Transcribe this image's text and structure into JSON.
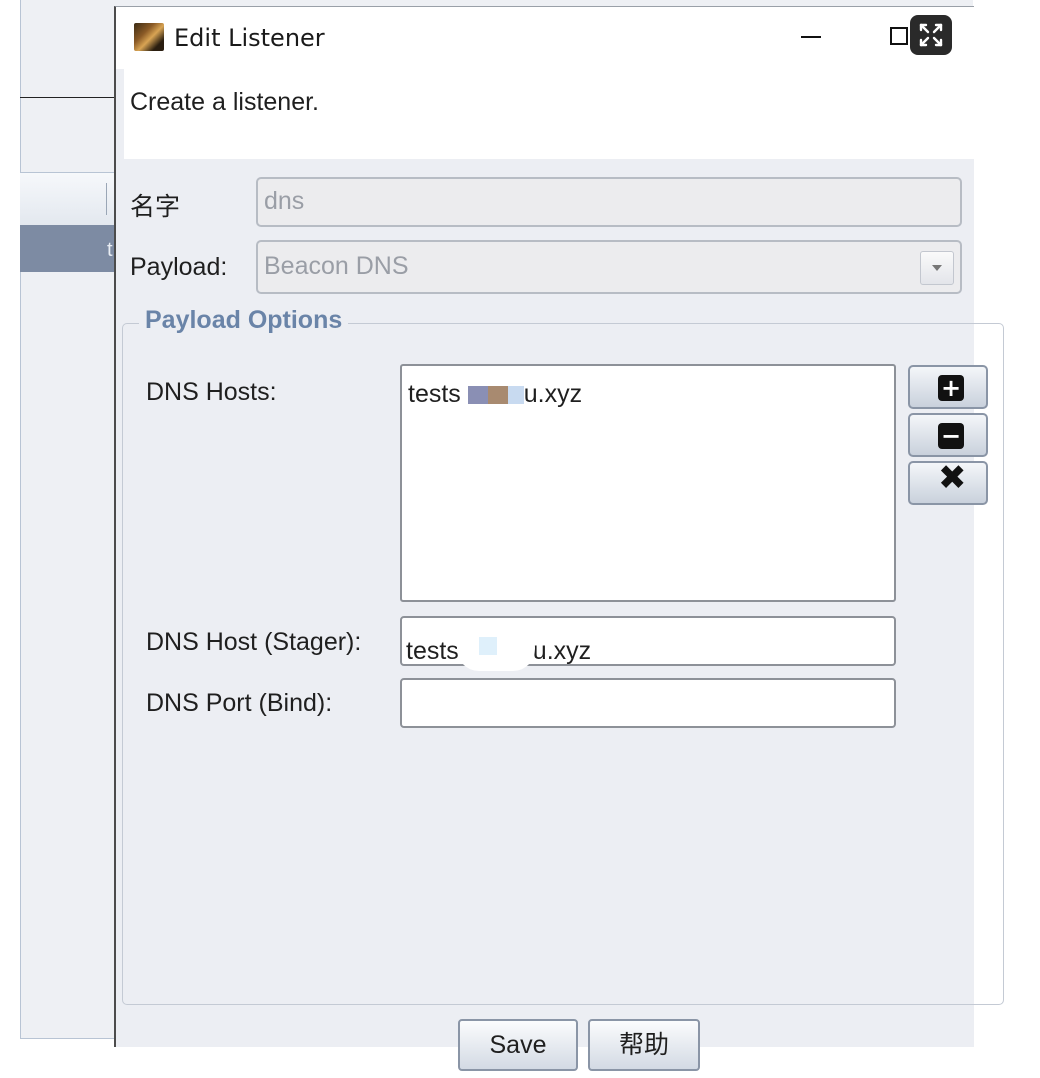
{
  "background_app": {
    "row_cell_text": "t"
  },
  "window": {
    "title": "Edit Listener",
    "description": "Create a listener."
  },
  "form": {
    "name_label": "名字",
    "name_value": "dns",
    "payload_label": "Payload:",
    "payload_value": "Beacon DNS"
  },
  "payload_options": {
    "legend": "Payload Options",
    "dns_hosts_label": "DNS Hosts:",
    "dns_hosts": [
      {
        "prefix": "tests",
        "suffix": "u.xyz"
      }
    ],
    "dns_host_stager_label": "DNS Host (Stager):",
    "dns_host_stager_prefix": "tests",
    "dns_host_stager_suffix": "u.xyz",
    "dns_port_bind_label": "DNS Port (Bind):",
    "dns_port_bind_value": ""
  },
  "side_buttons": {
    "add_icon": "plus-icon",
    "remove_icon": "minus-icon",
    "clear_icon": "x-icon"
  },
  "footer": {
    "save_label": "Save",
    "help_label": "帮助"
  }
}
